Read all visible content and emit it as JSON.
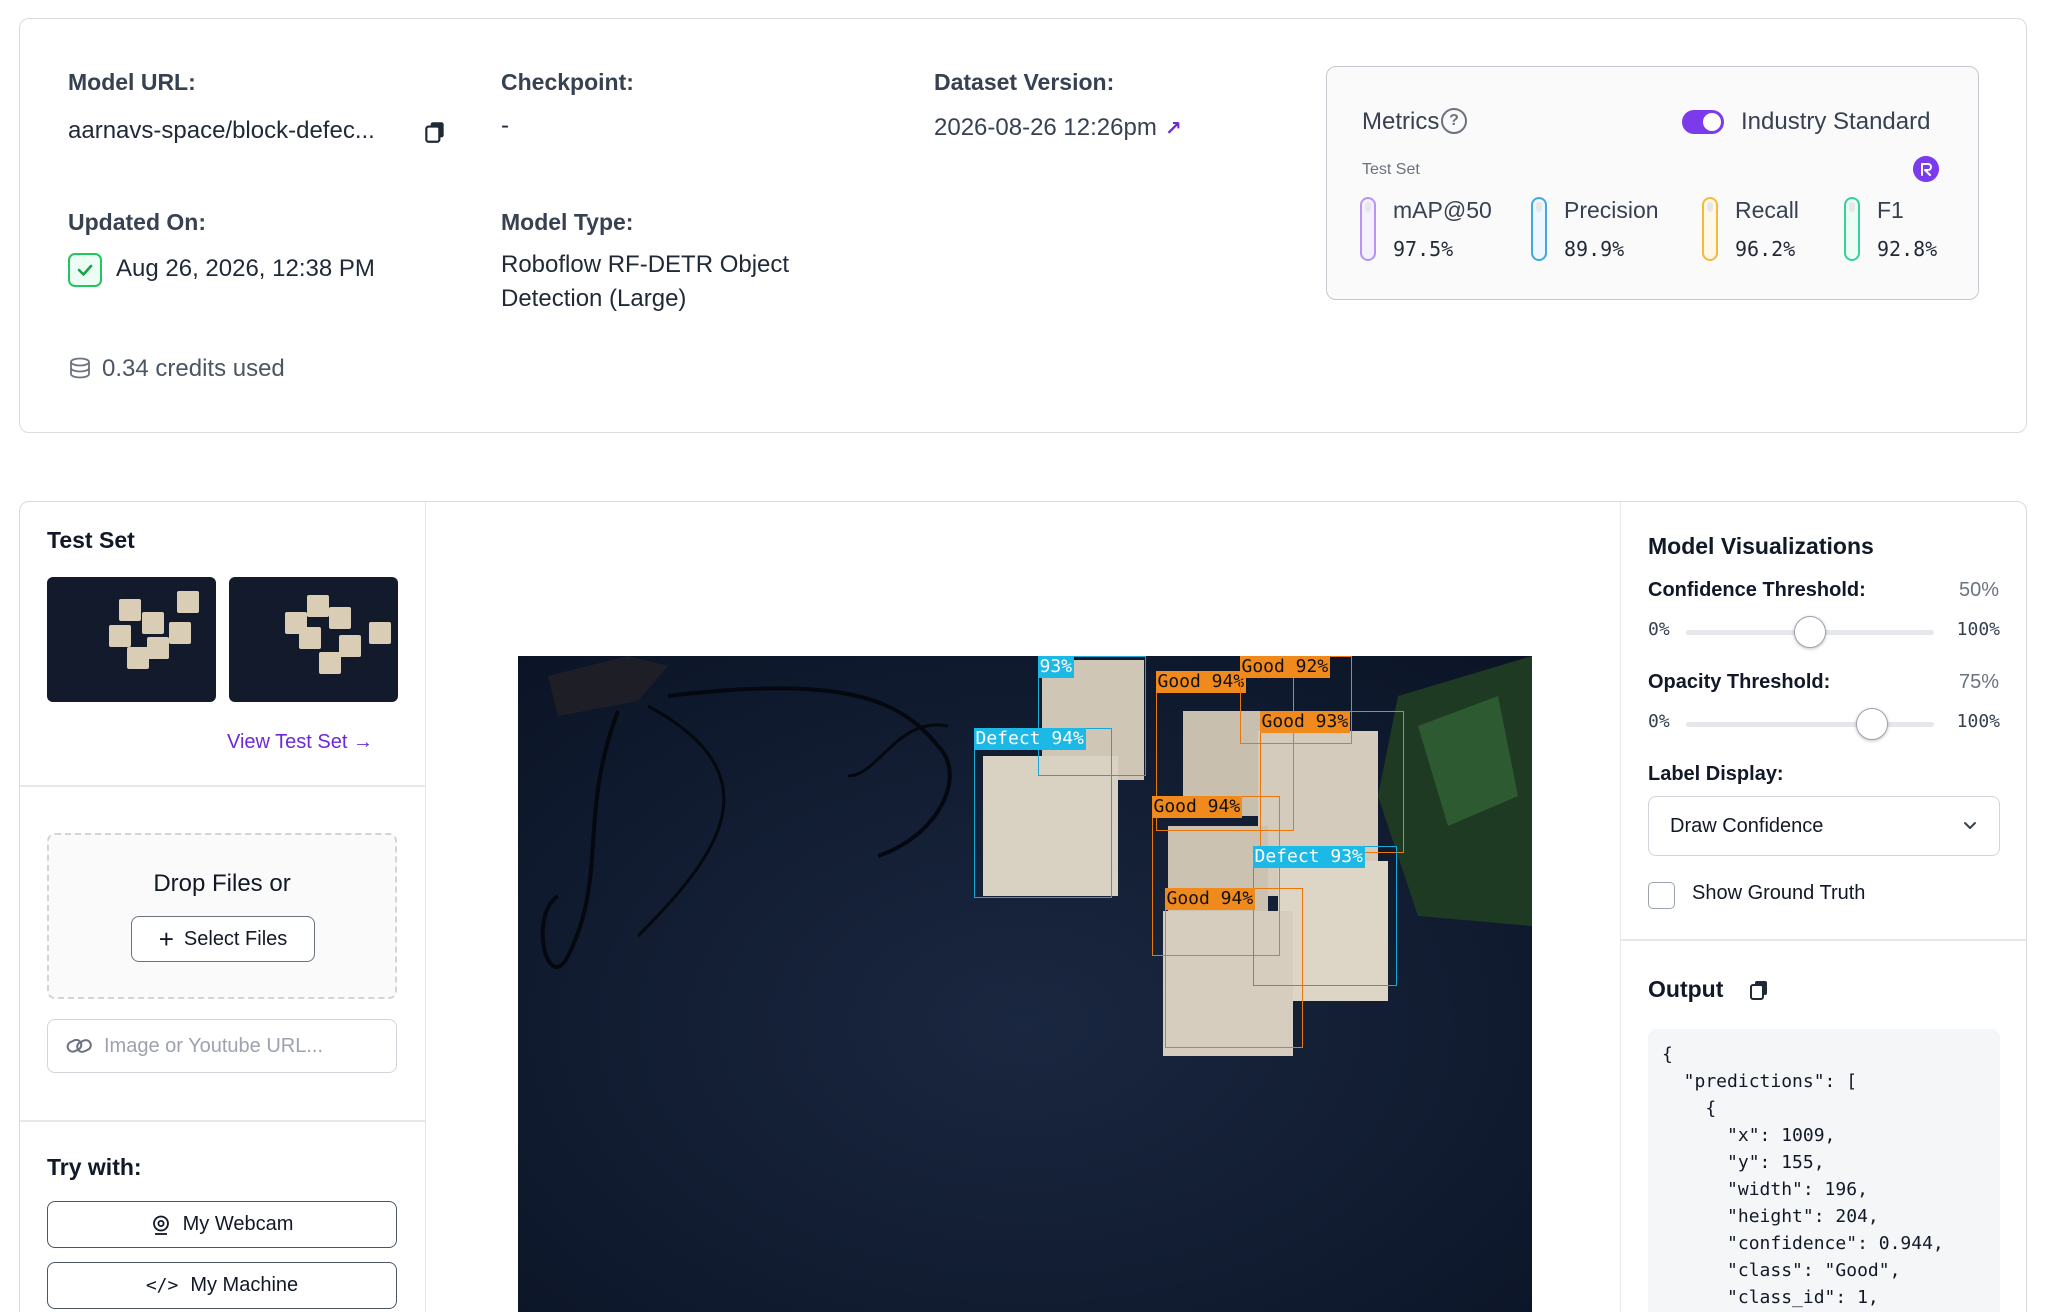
{
  "model_info": {
    "model_url_label": "Model URL:",
    "model_url_value": "aarnavs-space/block-defec...",
    "checkpoint_label": "Checkpoint:",
    "checkpoint_value": "-",
    "dataset_version_label": "Dataset Version:",
    "dataset_version_value": "2026-08-26 12:26pm",
    "updated_on_label": "Updated On:",
    "updated_on_value": "Aug 26, 2026, 12:38 PM",
    "model_type_label": "Model Type:",
    "model_type_line1": "Roboflow RF-DETR Object",
    "model_type_line2": "Detection (Large)",
    "credits": "0.34 credits used"
  },
  "metrics": {
    "title": "Metrics",
    "toggle_label": "Industry Standard",
    "toggle_on": true,
    "subset": "Test Set",
    "items": [
      {
        "name": "mAP@50",
        "value": "97.5%",
        "color": "#b794f4"
      },
      {
        "name": "Precision",
        "value": "89.9%",
        "color": "#3fa9e0"
      },
      {
        "name": "Recall",
        "value": "96.2%",
        "color": "#f5b93b"
      },
      {
        "name": "F1",
        "value": "92.8%",
        "color": "#34d399"
      }
    ]
  },
  "left_panel": {
    "test_set_title": "Test Set",
    "view_test_set": "View Test Set →",
    "drop_text": "Drop Files or",
    "select_files": "Select Files",
    "url_placeholder": "Image or Youtube URL...",
    "try_with": "Try with:",
    "webcam": "My Webcam",
    "machine": "My Machine"
  },
  "detections": [
    {
      "label": "93%",
      "class": "defect"
    },
    {
      "label": "Good 94%",
      "class": "good"
    },
    {
      "label": "Good 92%",
      "class": "good"
    },
    {
      "label": "Defect 94%",
      "class": "defect"
    },
    {
      "label": "Good 93%",
      "class": "good"
    },
    {
      "label": "Good 94%",
      "class": "good"
    },
    {
      "label": "Defect 93%",
      "class": "defect"
    },
    {
      "label": "Good 94%",
      "class": "good"
    }
  ],
  "visualizations": {
    "title": "Model Visualizations",
    "confidence_label": "Confidence Threshold:",
    "confidence_value": "50%",
    "opacity_label": "Opacity Threshold:",
    "opacity_value": "75%",
    "min": "0%",
    "max": "100%",
    "confidence_level": 0.5,
    "opacity_level": 0.75,
    "label_display_label": "Label Display:",
    "label_display_value": "Draw Confidence",
    "show_ground_truth": "Show Ground Truth",
    "show_ground_truth_checked": false
  },
  "output": {
    "title": "Output",
    "code": "{\n  \"predictions\": [\n    {\n      \"x\": 1009,\n      \"y\": 155,\n      \"width\": 196,\n      \"height\": 204,\n      \"confidence\": 0.944,\n      \"class\": \"Good\",\n      \"class_id\": 1,"
  },
  "icons": [
    "copy-icon",
    "check-icon",
    "arrow-up-right-icon",
    "help-icon",
    "roboflow-icon",
    "credits-icon",
    "plus-icon",
    "link-icon",
    "webcam-icon",
    "code-icon",
    "chevron-down-icon"
  ]
}
